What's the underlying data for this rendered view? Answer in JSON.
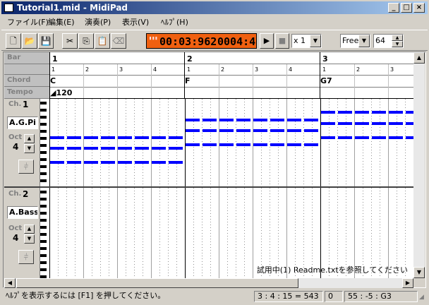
{
  "window": {
    "title": "Tutorial1.mid - MidiPad"
  },
  "menu": [
    "ファイル(F)",
    "編集(E)",
    "演奏(P)",
    "表示(V)",
    "ﾍﾙﾌﾟ(H)"
  ],
  "toolbar": {
    "time": "00:03:962",
    "measure": "0004:4",
    "speed": "x 1",
    "snap": "Free",
    "quantize": "64"
  },
  "ruler": {
    "bar_label": "Bar",
    "chord_label": "Chord",
    "tempo_label": "Tempo",
    "bars": [
      "1",
      "2",
      "3"
    ],
    "beats": [
      "1",
      "2",
      "3",
      "4"
    ],
    "chords": [
      "C",
      "F",
      "G7"
    ],
    "tempo": "120"
  },
  "channels": [
    {
      "ch_label": "Ch.",
      "ch": "1",
      "instrument": "A.G.Pi",
      "oct_label": "Oct",
      "oct": "4"
    },
    {
      "ch_label": "Ch.",
      "ch": "2",
      "instrument": "A.Bass",
      "oct_label": "Oct",
      "oct": "4"
    }
  ],
  "trial_notice": "試用中(1) Readme.txtを参照してください",
  "status": {
    "help": "ﾍﾙﾌﾟを表示するには [F1] を押してください。",
    "position": "3 : 4 : 15 = 543",
    "value": "0",
    "note": "55 : -5 : G3"
  },
  "colors": {
    "note": "#0000ff",
    "title_start": "#0a246a",
    "time_bg": "#f06010"
  }
}
